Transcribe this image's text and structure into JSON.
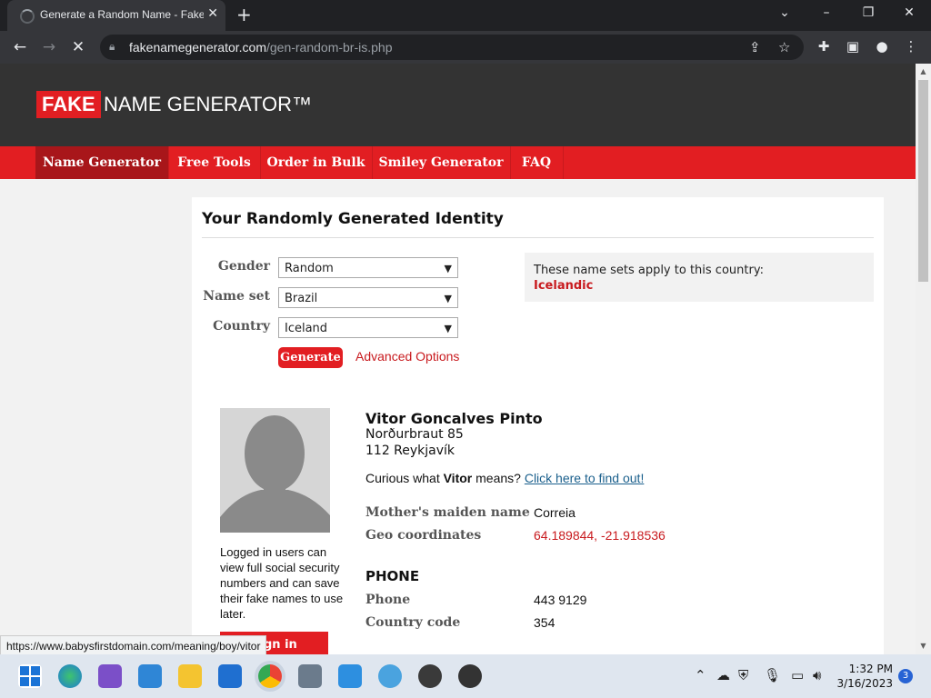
{
  "browser": {
    "tab_title": "Generate a Random Name - Fake Name Generator",
    "tab_close": "✕",
    "new_tab": "+",
    "url_host": "fakenamegenerator.com",
    "url_path": "/gen-random-br-is.php",
    "status_url": "https://www.babysfirstdomain.com/meaning/boy/vitor",
    "window_controls": [
      "⌄",
      "–",
      "❐",
      "✕"
    ]
  },
  "site": {
    "logo_fake": "FAKE",
    "logo_rest": "NAME GENERATOR™",
    "nav": [
      "Name Generator",
      "Free Tools",
      "Order in Bulk",
      "Smiley Generator",
      "FAQ"
    ]
  },
  "form": {
    "title": "Your Randomly Generated Identity",
    "gender_label": "Gender",
    "gender_value": "Random",
    "nameset_label": "Name set",
    "nameset_value": "Brazil",
    "country_label": "Country",
    "country_value": "Iceland",
    "generate_label": "Generate",
    "advanced_label": "Advanced Options",
    "info_text": "These name sets apply to this country:",
    "info_country": "Icelandic"
  },
  "identity": {
    "name": "Vitor Goncalves Pinto",
    "address_line1": "Norðurbraut 85",
    "address_line2": "112 Reykjavík",
    "curious_prefix": "Curious what ",
    "first_name": "Vitor",
    "curious_suffix": " means? ",
    "curious_link": "Click here to find out!",
    "maiden_label": "Mother's maiden name",
    "maiden_value": "Correia",
    "geo_label": "Geo coordinates",
    "geo_value": "64.189844, -21.918536",
    "phone_heading": "PHONE",
    "phone_label": "Phone",
    "phone_value": "443 9129",
    "cc_label": "Country code",
    "cc_value": "354",
    "logged_text": "Logged in users can view full social security numbers and can save their fake names to use later.",
    "signin_label": "Sign in"
  },
  "taskbar": {
    "time": "1:32 PM",
    "date": "3/16/2023",
    "notifications": "3"
  },
  "colors": {
    "brand_red": "#e21e22",
    "header_dark": "#333333",
    "link_red": "#c81a1e",
    "link_blue": "#1a5f8c"
  }
}
